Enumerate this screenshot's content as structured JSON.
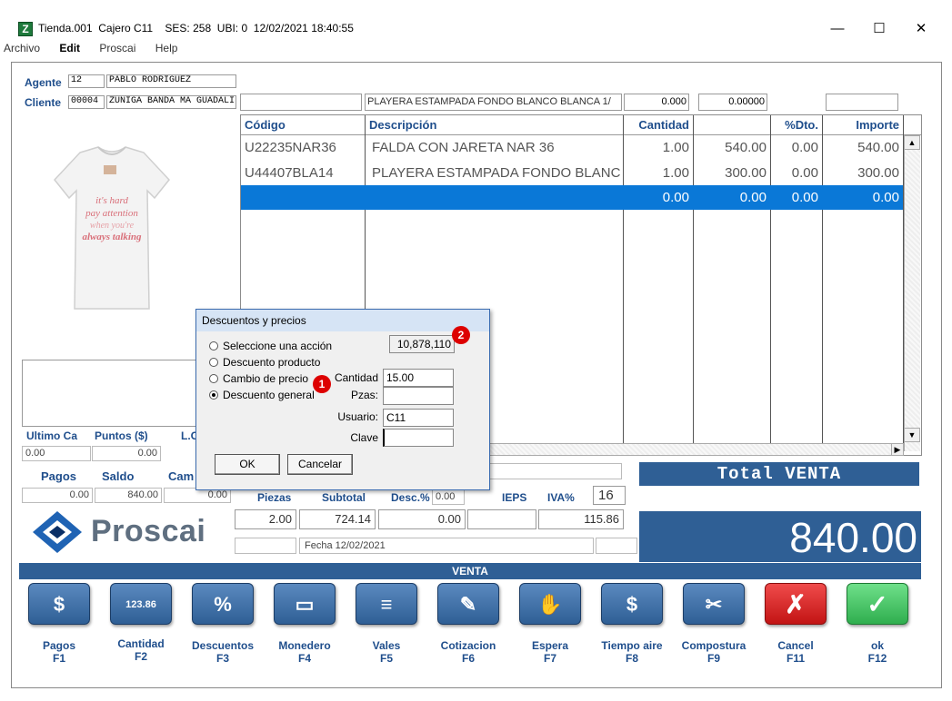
{
  "window": {
    "title": "Tienda.001  Cajero C11    SES: 258  UBI: 0  12/02/2021 18:40:55",
    "icon_letter": "Z",
    "controls": {
      "minimize": "—",
      "maximize": "☐",
      "close": "✕"
    }
  },
  "menu": [
    "Archivo",
    "Edit",
    "Proscai",
    "Help"
  ],
  "header": {
    "agente_label": "Agente",
    "agente_code": "12",
    "agente_name": "PABLO RODRIGUEZ",
    "cliente_label": "Cliente",
    "cliente_code": "00004",
    "cliente_name": "ZUÑIGA BANDA MA GUADALI",
    "item_desc": "PLAYERA ESTAMPADA FONDO BLANCO BLANCA 1/",
    "field_qty": "0.000",
    "field_price": "0.00000"
  },
  "grid": {
    "headers": [
      "Código",
      "Descripción",
      "Cantidad",
      "",
      "%Dto.",
      "Importe"
    ],
    "rows": [
      {
        "codigo": "U22235NAR36",
        "descripcion": "FALDA CON JARETA NAR 36",
        "cantidad": "1.00",
        "precio": "540.00",
        "dto": "0.00",
        "importe": "540.00"
      },
      {
        "codigo": "U44407BLA14",
        "descripcion": "PLAYERA ESTAMPADA FONDO BLANC",
        "cantidad": "1.00",
        "precio": "300.00",
        "dto": "0.00",
        "importe": "300.00"
      },
      {
        "codigo": "",
        "descripcion": "",
        "cantidad": "0.00",
        "precio": "0.00",
        "dto": "0.00",
        "importe": "0.00"
      }
    ]
  },
  "left_panel": {
    "shirt_text": "it's hard to pay attention when you're always talking",
    "ultimo_label": "Ultimo Ca",
    "puntos_label": "Puntos ($)",
    "lc_label": "L.C",
    "ultimo_val": "0.00",
    "puntos_val": "0.00",
    "pagos_label": "Pagos",
    "saldo_label": "Saldo",
    "cambio_label": "Cam",
    "pagos_val": "0.00",
    "saldo_val": "840.00",
    "cambio_val": "0.00"
  },
  "dialog": {
    "title": "Descuentos y precios",
    "options": [
      "Seleccione una acción",
      "Descuento producto",
      "Cambio de precio",
      "Descuento general"
    ],
    "selected_index": 3,
    "number_field": "10,878,110",
    "cantidad_label": "Cantidad",
    "cantidad_value": "15.00",
    "pzas_label": "Pzas:",
    "pzas_value": "",
    "usuario_label": "Usuario:",
    "usuario_value": "C11",
    "clave_label": "Clave",
    "clave_value": "",
    "ok_label": "OK",
    "cancel_label": "Cancelar",
    "marker1": "1",
    "marker2": "2"
  },
  "totals": {
    "piezas_label": "Piezas",
    "subtotal_label": "Subtotal",
    "desc_label": "Desc.%",
    "desc_pct": "0.00",
    "ieps_label": "IEPS",
    "iva_label": "IVA%",
    "iva_pct": "16",
    "piezas": "2.00",
    "subtotal": "724.14",
    "descuento": "0.00",
    "iva": "115.86",
    "fecha": "Fecha 12/02/2021",
    "total_label": "Total VENTA",
    "total": "840.00"
  },
  "logo": "Proscai",
  "mode_bar": "VENTA",
  "function_keys": [
    {
      "label": "Pagos",
      "key": "F1",
      "icon": "$"
    },
    {
      "label": "Cantidad",
      "key": "F2",
      "icon": "123.86"
    },
    {
      "label": "Descuentos",
      "key": "F3",
      "icon": "%"
    },
    {
      "label": "Monedero",
      "key": "F4",
      "icon": "▭"
    },
    {
      "label": "Vales",
      "key": "F5",
      "icon": "≡"
    },
    {
      "label": "Cotizacion",
      "key": "F6",
      "icon": "✎"
    },
    {
      "label": "Espera",
      "key": "F7",
      "icon": "✋"
    },
    {
      "label": "Tiempo aire",
      "key": "F8",
      "icon": "$"
    },
    {
      "label": "Compostura",
      "key": "F9",
      "icon": "✂"
    },
    {
      "label": "Cancel",
      "key": "F11",
      "icon": "✗"
    },
    {
      "label": "ok",
      "key": "F12",
      "icon": "✓"
    }
  ],
  "colors": {
    "accent": "#2f5f95",
    "selection": "#0a78d7",
    "label": "#1f4e8c",
    "cancel": "#d11a1a",
    "ok": "#3cc05c"
  }
}
